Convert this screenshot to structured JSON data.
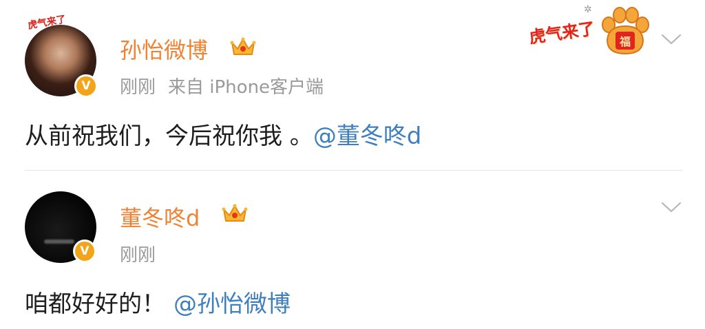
{
  "posts": [
    {
      "author": "孙怡微博",
      "time": "刚刚",
      "source": "来自 iPhone客户端",
      "text": "从前祝我们，今后祝你我 。",
      "mention": "@董冬咚d",
      "avatar_sticker": "虎气来了",
      "verified_icon": "verified-v-icon",
      "crown_icon": "crown-icon",
      "promo": {
        "text": "虎气来了",
        "icon": "tiger-paw-icon",
        "paw_label": "福"
      }
    },
    {
      "author": "董冬咚d",
      "time": "刚刚",
      "text": "咱都好好的！",
      "mention": "@孙怡微博",
      "verified_icon": "verified-v-icon",
      "crown_icon": "crown-icon"
    }
  ],
  "colors": {
    "name": "#f08233",
    "mention": "#3f7fbf",
    "meta": "#9a9a9a",
    "text": "#1e1e1e",
    "verified": "#f2a51a",
    "promo_red": "#e0261c"
  }
}
